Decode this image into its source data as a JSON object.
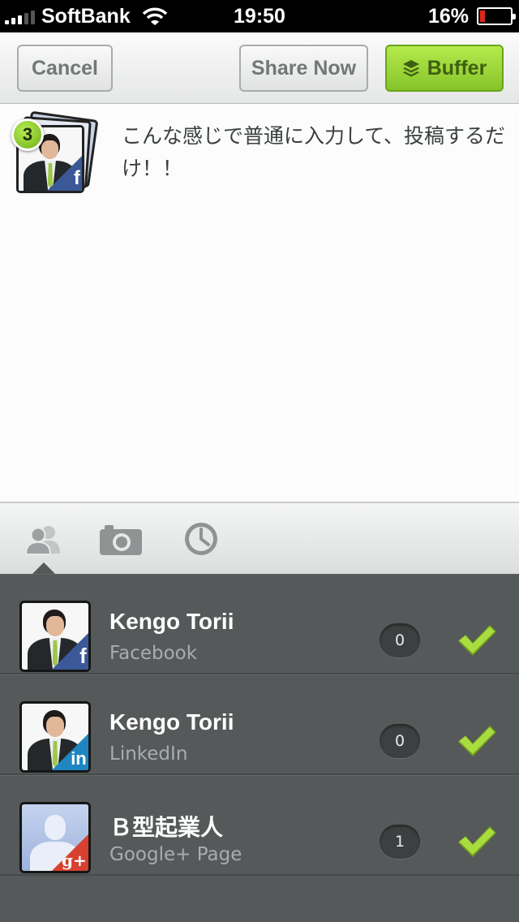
{
  "status_bar": {
    "carrier": "SoftBank",
    "time": "19:50",
    "battery": "16%",
    "battery_level": 0.16
  },
  "toolbar": {
    "cancel_label": "Cancel",
    "share_now_label": "Share Now",
    "buffer_label": "Buffer"
  },
  "composer": {
    "selected_count": "3",
    "text": "こんな感じで普通に入力して、投稿するだけ！！"
  },
  "tabs": [
    {
      "icon": "accounts-icon",
      "active": true
    },
    {
      "icon": "camera-icon",
      "active": false
    },
    {
      "icon": "clock-icon",
      "active": false
    }
  ],
  "accounts": [
    {
      "name": "Kengo Torii",
      "service": "Facebook",
      "count": "0",
      "selected": true,
      "badge": "f"
    },
    {
      "name": "Kengo Torii",
      "service": "LinkedIn",
      "count": "0",
      "selected": true,
      "badge": "in"
    },
    {
      "name": "Ｂ型起業人",
      "service": "Google+ Page",
      "count": "1",
      "selected": true,
      "badge": "g+"
    }
  ],
  "colors": {
    "buffer_green": "#86c42a",
    "facebook": "#3b5998",
    "linkedin": "#1f86c1",
    "google_plus": "#d8402f",
    "list_bg": "#565959"
  }
}
